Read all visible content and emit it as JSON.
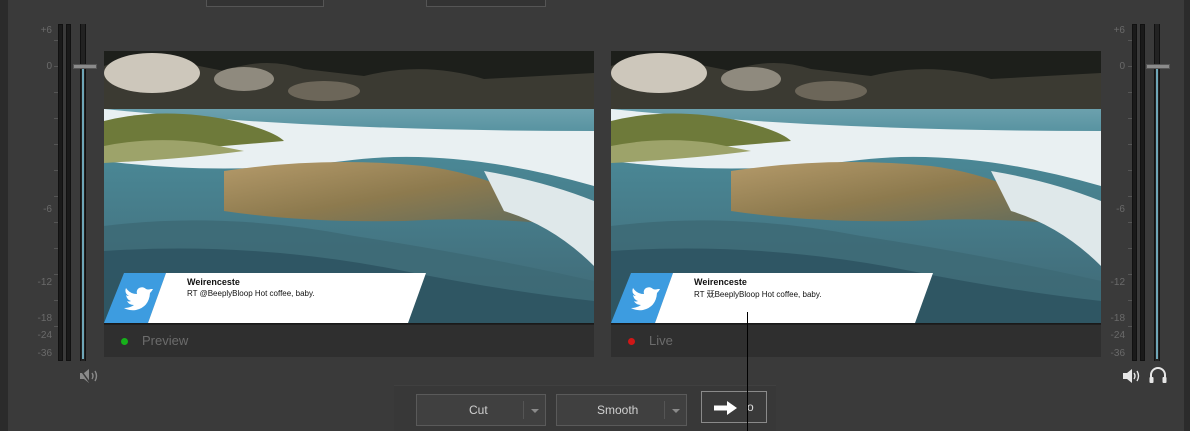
{
  "left_meter": {
    "scale": [
      "+6",
      "0",
      "-6",
      "-12",
      "-18",
      "-24",
      "-36"
    ],
    "icon": "speaker-muted-icon"
  },
  "right_meter": {
    "scale": [
      "+6",
      "0",
      "-6",
      "-12",
      "-18",
      "-24",
      "-36"
    ],
    "icons": [
      "speaker-icon",
      "headphones-icon"
    ]
  },
  "preview": {
    "label": "Preview",
    "status_color": "#16b11a",
    "overlay": {
      "name": "Weirenceste",
      "text": "RT @BeeplyBloop Hot coffee, baby."
    }
  },
  "live": {
    "label": "Live",
    "status_color": "#d01717",
    "overlay": {
      "name": "Weirenceste",
      "text": "RT 兓BeeplyBloop Hot coffee, baby."
    }
  },
  "transition": {
    "cut_label": "Cut",
    "smooth_label": "Smooth",
    "go_suffix": "o"
  },
  "colors": {
    "twitter_blue": "#3d9ce0",
    "meter_accent": "#6fa7b8"
  }
}
